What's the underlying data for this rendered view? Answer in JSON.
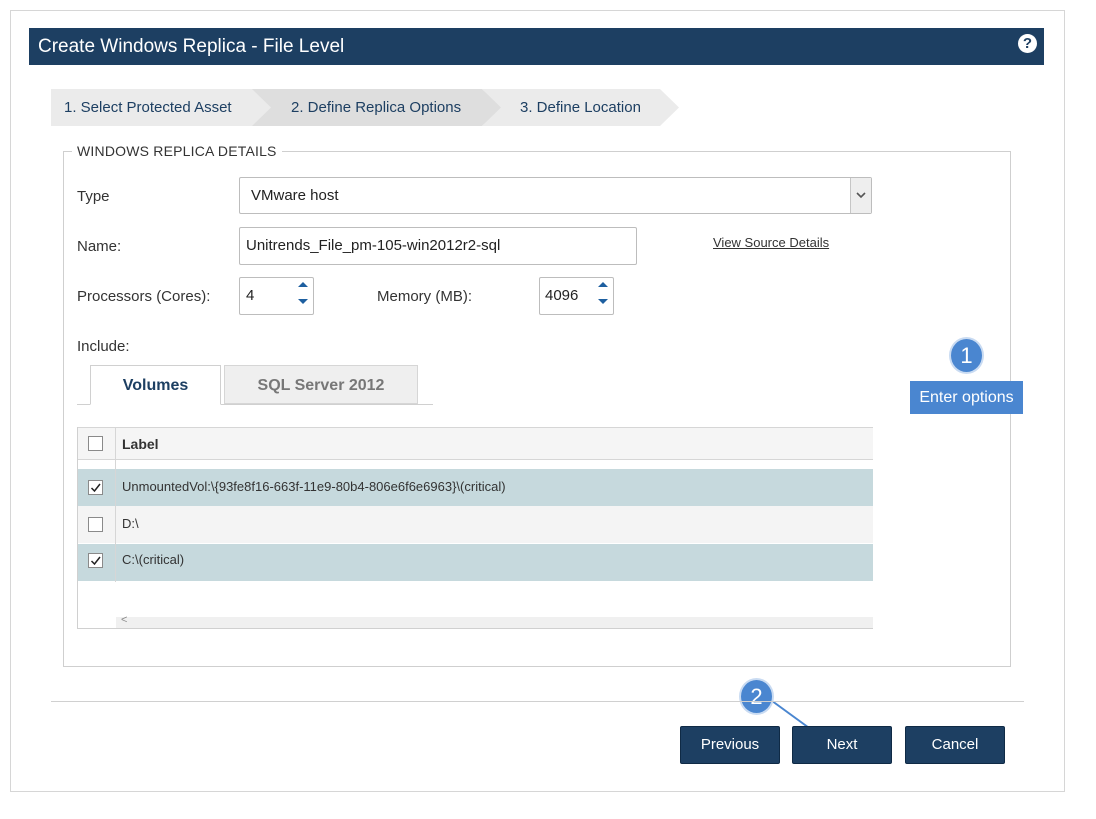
{
  "dialog": {
    "title": "Create Windows Replica - File Level",
    "help_icon": "?"
  },
  "wizard": {
    "steps": [
      {
        "label": "1. Select Protected Asset"
      },
      {
        "label": "2. Define Replica Options"
      },
      {
        "label": "3. Define Location"
      }
    ]
  },
  "details": {
    "legend": "WINDOWS REPLICA DETAILS",
    "type_label": "Type",
    "type_value": "VMware host",
    "name_label": "Name:",
    "name_value": "Unitrends_File_pm-105-win2012r2-sql",
    "view_source": "View Source Details",
    "processors_label": "Processors (Cores):",
    "processors_value": "4",
    "memory_label": "Memory (MB):",
    "memory_value": "4096",
    "include_label": "Include:"
  },
  "tabs": [
    {
      "label": "Volumes"
    },
    {
      "label": "SQL Server 2012"
    }
  ],
  "grid": {
    "column_label": "Label",
    "rows": [
      {
        "label": "UnmountedVol:\\{93fe8f16-663f-11e9-80b4-806e6f6e6963}\\(critical)",
        "checked": true
      },
      {
        "label": "D:\\",
        "checked": false
      },
      {
        "label": "C:\\(critical)",
        "checked": true
      }
    ],
    "scroll_left_glyph": "<"
  },
  "callouts": {
    "one": "1",
    "one_text": "Enter options",
    "two": "2"
  },
  "buttons": {
    "previous": "Previous",
    "next": "Next",
    "cancel": "Cancel"
  },
  "colors": {
    "header_bg": "#1d3f62",
    "selected_row": "#c6d9dd",
    "callout": "#4a86d0"
  }
}
